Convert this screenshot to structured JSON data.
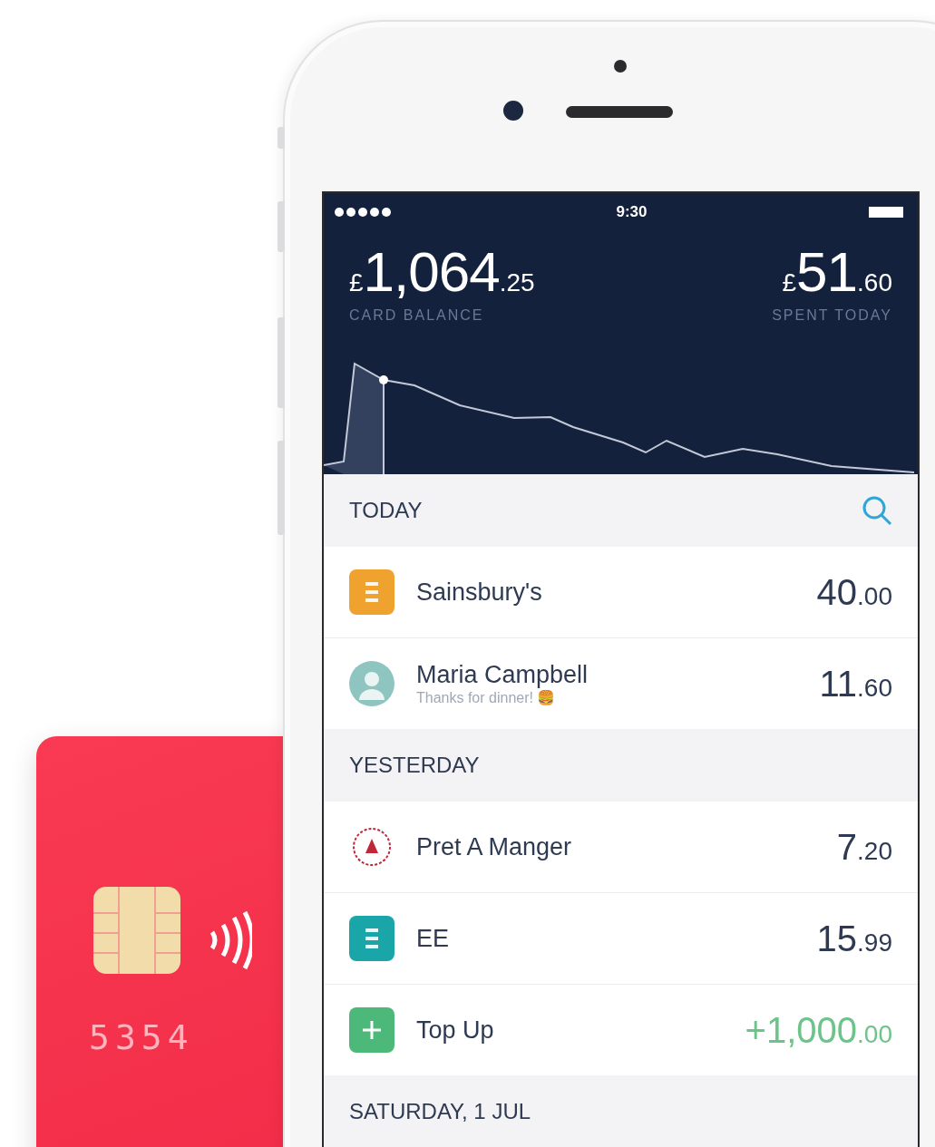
{
  "card": {
    "number": "5354"
  },
  "status_bar": {
    "time": "9:30"
  },
  "summary": [
    {
      "currency": "£",
      "whole": "1,064",
      "fraction": ".25",
      "label": "CARD BALANCE"
    },
    {
      "currency": "£",
      "whole": "51",
      "fraction": ".60",
      "label": "SPENT TODAY"
    }
  ],
  "sections": [
    {
      "title": "TODAY",
      "search": true,
      "transactions": [
        {
          "kind": "logo",
          "color": "#f0a22e",
          "name": "Sainsbury's",
          "whole": "40",
          "fraction": ".00",
          "credit": false
        },
        {
          "kind": "avatar",
          "color": "#8fc5c0",
          "name": "Maria Campbell",
          "note": "Thanks for dinner! 🍔",
          "whole": "11",
          "fraction": ".60",
          "credit": false
        }
      ]
    },
    {
      "title": "YESTERDAY",
      "search": false,
      "transactions": [
        {
          "kind": "emblem",
          "color": "#c0283a",
          "name": "Pret A Manger",
          "whole": "7",
          "fraction": ".20",
          "credit": false
        },
        {
          "kind": "logo",
          "color": "#1aa6a8",
          "name": "EE",
          "whole": "15",
          "fraction": ".99",
          "credit": false
        },
        {
          "kind": "topup",
          "color": "#4cb87a",
          "name": "Top Up",
          "whole": "+1,000",
          "fraction": ".00",
          "credit": true
        }
      ]
    },
    {
      "title": "SATURDAY, 1 JUL",
      "search": false
    }
  ]
}
